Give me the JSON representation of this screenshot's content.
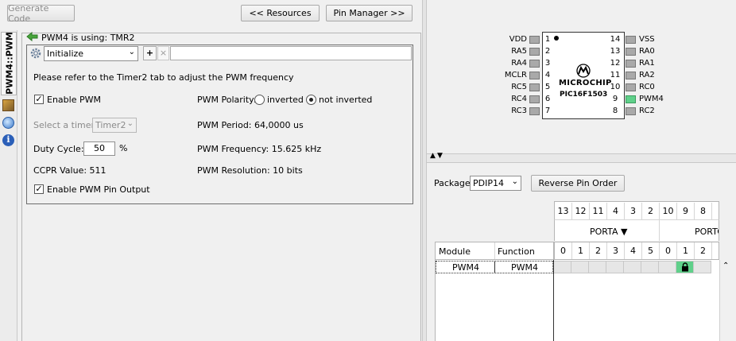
{
  "toolbar": {
    "generate_code": "Generate Code",
    "resources": "<< Resources",
    "pin_manager": "Pin Manager >>"
  },
  "side_tab": {
    "label": "PWM4::PWM"
  },
  "pwm": {
    "using_label": "PWM4 is using: TMR2",
    "init_select": "Initialize",
    "add": "+",
    "remove": "×",
    "info_text": "Please refer to the Timer2 tab to adjust the PWM frequency",
    "enable_pwm": "Enable PWM",
    "polarity_label": "PWM Polarity:",
    "polarity_inverted": "inverted",
    "polarity_not_inverted": "not inverted",
    "polarity_selected": "not inverted",
    "timer_label": "Select a timer:",
    "timer_value": "Timer2",
    "period": "PWM Period: 64,0000 us",
    "duty_label": "Duty Cycle:",
    "duty_value": "50",
    "duty_unit": "%",
    "frequency": "PWM Frequency: 15.625 kHz",
    "ccpr": "CCPR Value: 511",
    "resolution": "PWM Resolution: 10 bits",
    "enable_pin_output": "Enable PWM Pin Output"
  },
  "chip": {
    "logo": "MICROCHIP",
    "part": "PIC16F1503",
    "left_pins": [
      {
        "num": "1",
        "name": "VDD"
      },
      {
        "num": "2",
        "name": "RA5"
      },
      {
        "num": "3",
        "name": "RA4"
      },
      {
        "num": "4",
        "name": "MCLR"
      },
      {
        "num": "5",
        "name": "RC5"
      },
      {
        "num": "6",
        "name": "RC4"
      },
      {
        "num": "7",
        "name": "RC3"
      }
    ],
    "right_pins": [
      {
        "num": "14",
        "name": "VSS"
      },
      {
        "num": "13",
        "name": "RA0"
      },
      {
        "num": "12",
        "name": "RA1"
      },
      {
        "num": "11",
        "name": "RA2"
      },
      {
        "num": "10",
        "name": "RC0"
      },
      {
        "num": "9",
        "name": "PWM4",
        "active": true
      },
      {
        "num": "8",
        "name": "RC2"
      }
    ]
  },
  "pin_manager": {
    "package_label": "Package",
    "package_value": "PDIP14",
    "reverse_button": "Reverse Pin Order",
    "pin_numbers": [
      "13",
      "12",
      "11",
      "4",
      "3",
      "2",
      "10",
      "9",
      "8"
    ],
    "port_a_label": "PORTA ▼",
    "port_c_label": "PORTC",
    "bits": [
      "0",
      "1",
      "2",
      "3",
      "4",
      "5",
      "0",
      "1",
      "2"
    ],
    "col_module": "Module",
    "col_function": "Function",
    "rows": [
      {
        "module": "PWM4",
        "function": "PWM4",
        "locked_index": 7
      }
    ]
  }
}
